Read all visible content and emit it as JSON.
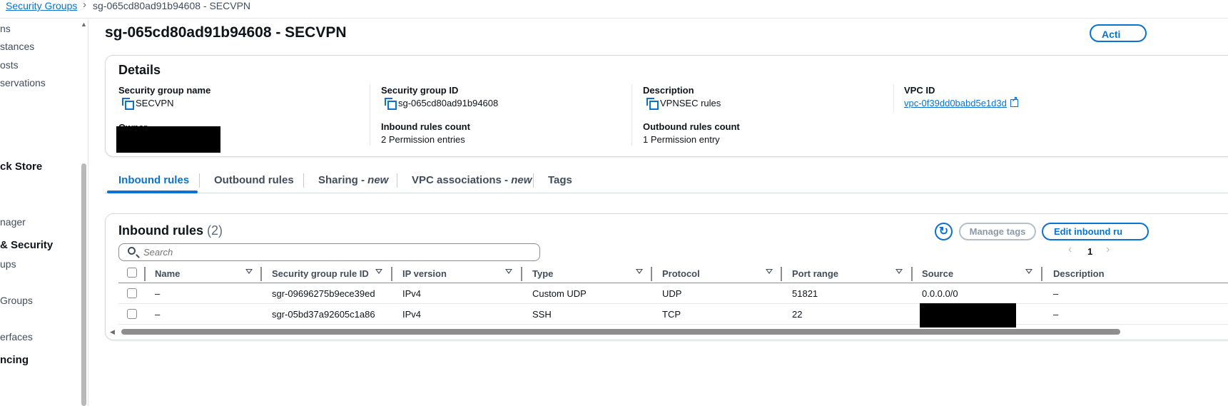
{
  "breadcrumb": {
    "parent": "Security Groups",
    "current": "sg-065cd80ad91b94608 - SECVPN"
  },
  "sidebar": {
    "items": [
      {
        "label": "ns",
        "kind": "item"
      },
      {
        "label": "stances",
        "kind": "item"
      },
      {
        "label": "osts",
        "kind": "item"
      },
      {
        "label": "servations",
        "kind": "item"
      },
      {
        "label": "ck Store",
        "kind": "heading"
      },
      {
        "label": "nager",
        "kind": "item"
      },
      {
        "label": "& Security",
        "kind": "heading"
      },
      {
        "label": "ups",
        "kind": "item"
      },
      {
        "label": "Groups",
        "kind": "item"
      },
      {
        "label": "erfaces",
        "kind": "item"
      },
      {
        "label": "ncing",
        "kind": "heading"
      }
    ]
  },
  "header": {
    "title": "sg-065cd80ad91b94608 - SECVPN",
    "actions_label": "Acti"
  },
  "details": {
    "title": "Details",
    "sg_name_label": "Security group name",
    "sg_name": "SECVPN",
    "sg_id_label": "Security group ID",
    "sg_id": "sg-065cd80ad91b94608",
    "description_label": "Description",
    "description": "VPNSEC rules",
    "vpc_label": "VPC ID",
    "vpc_id": "vpc-0f39dd0babd5e1d3d",
    "owner_label": "Owner",
    "inbound_count_label": "Inbound rules count",
    "inbound_count": "2 Permission entries",
    "outbound_count_label": "Outbound rules count",
    "outbound_count": "1 Permission entry"
  },
  "tabs": [
    {
      "label": "Inbound rules",
      "suffix": "",
      "active": true
    },
    {
      "label": "Outbound rules",
      "suffix": "",
      "active": false
    },
    {
      "label": "Sharing - ",
      "suffix": "new",
      "active": false
    },
    {
      "label": "VPC associations - ",
      "suffix": "new",
      "active": false
    },
    {
      "label": "Tags",
      "suffix": "",
      "active": false
    }
  ],
  "rules": {
    "title": "Inbound rules",
    "count": "(2)",
    "manage_tags_label": "Manage tags",
    "edit_label": "Edit inbound ru",
    "search_placeholder": "Search",
    "page": "1",
    "columns": [
      "Name",
      "Security group rule ID",
      "IP version",
      "Type",
      "Protocol",
      "Port range",
      "Source",
      "Description"
    ],
    "rows": [
      {
        "name": "–",
        "rule_id": "sgr-09696275b9ece39ed",
        "ip": "IPv4",
        "type": "Custom UDP",
        "protocol": "UDP",
        "port": "51821",
        "source": "0.0.0.0/0",
        "description": "–"
      },
      {
        "name": "–",
        "rule_id": "sgr-05bd37a92605c1a86",
        "ip": "IPv4",
        "type": "SSH",
        "protocol": "TCP",
        "port": "22",
        "source": "",
        "description": "–"
      }
    ]
  },
  "colors": {
    "accent": "#0972d3",
    "text": "#0f141a",
    "border": "#d5dbdb"
  }
}
